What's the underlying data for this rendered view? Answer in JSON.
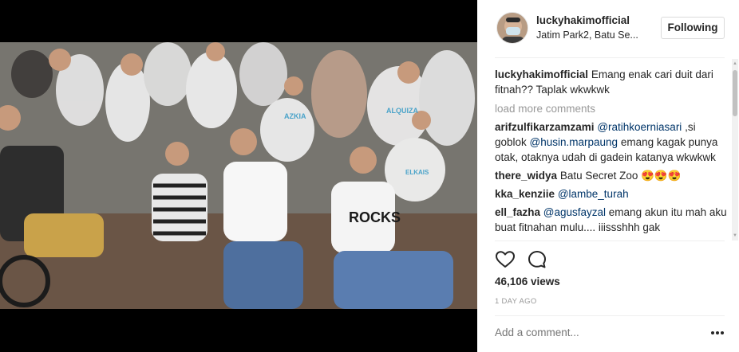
{
  "post": {
    "username": "luckyhakimofficial",
    "location": "Jatim Park2, Batu Se...",
    "follow_label": "Following",
    "caption": {
      "user": "luckyhakimofficial",
      "text": "Emang enak cari duit dari fitnah?? Taplak wkwkwk"
    },
    "load_more": "load more comments",
    "comments": [
      {
        "user": "arifzulfikarzamzami",
        "mention1": "@ratihkoerniasari",
        "text1": " ,si goblok ",
        "mention2": "@husin.marpaung",
        "text2": " emang kagak punya otak, otaknya udah di gadein katanya wkwkwk"
      },
      {
        "user": "there_widya",
        "text": "Batu Secret Zoo 😍😍😍"
      },
      {
        "user": "kka_kenziie",
        "mention": "@lambe_turah"
      },
      {
        "user": "ell_fazha",
        "mention": "@agusfayzal",
        "text": " emang akun itu mah aku buat fitnahan mulu.... iiissshhh gak"
      }
    ],
    "views": "46,106 views",
    "timestamp": "1 DAY AGO",
    "add_comment_placeholder": "Add a comment...",
    "icons": [
      "heart-icon",
      "comment-icon",
      "more-options-icon"
    ]
  },
  "video": {
    "shirt_texts": [
      "AZKIA",
      "ALQUIZA",
      "ELKAIS",
      "ROCKS"
    ]
  },
  "colors": {
    "mention": "#003569",
    "muted": "#999999",
    "border": "#dbdbdb"
  }
}
